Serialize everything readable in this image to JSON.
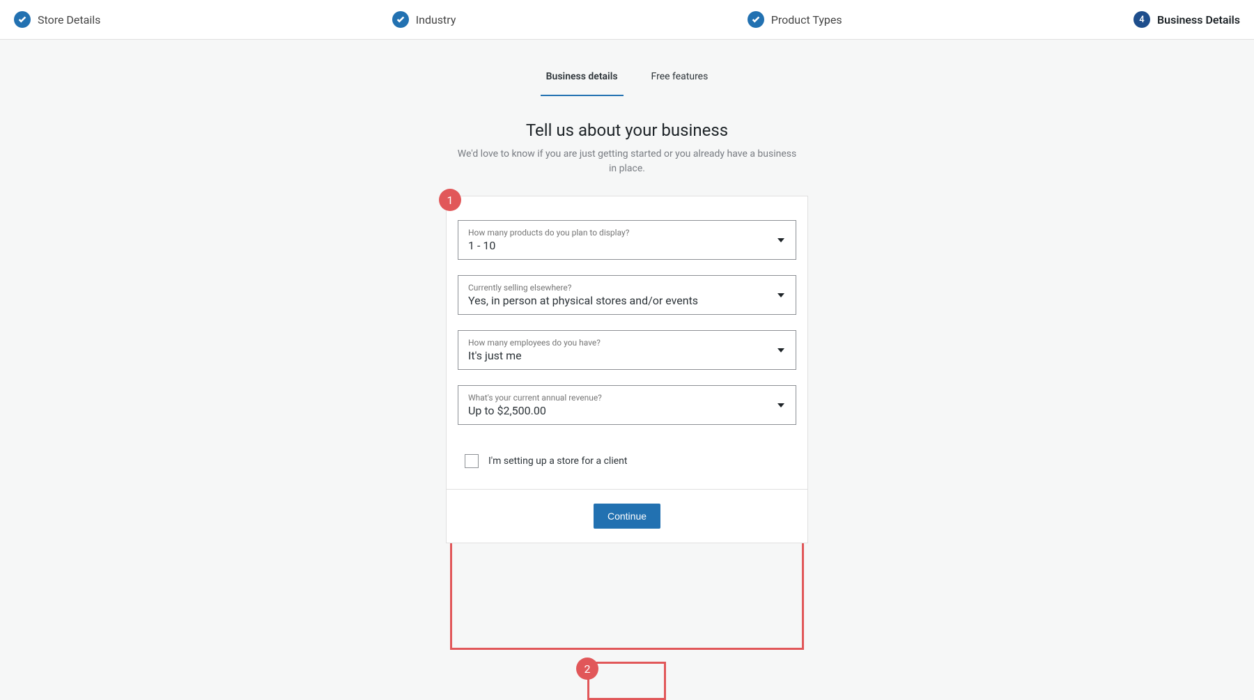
{
  "colors": {
    "accent": "#2271b1",
    "annotation": "#e15759"
  },
  "stepper": {
    "steps": [
      {
        "label": "Store Details",
        "done": true
      },
      {
        "label": "Industry",
        "done": true
      },
      {
        "label": "Product Types",
        "done": true
      },
      {
        "label": "Business Details",
        "number": "4",
        "active": true
      }
    ]
  },
  "tabs": {
    "items": [
      {
        "label": "Business details",
        "active": true
      },
      {
        "label": "Free features",
        "active": false
      }
    ]
  },
  "heading": {
    "title": "Tell us about your business",
    "subtitle": "We'd love to know if you are just getting started or you already have a business in place."
  },
  "form": {
    "fields": [
      {
        "label": "How many products do you plan to display?",
        "value": "1 - 10"
      },
      {
        "label": "Currently selling elsewhere?",
        "value": "Yes, in person at physical stores and/or events"
      },
      {
        "label": "How many employees do you have?",
        "value": "It's just me"
      },
      {
        "label": "What's your current annual revenue?",
        "value": "Up to $2,500.00"
      }
    ],
    "checkbox": {
      "checked": false,
      "label": "I'm setting up a store for a client"
    }
  },
  "footer": {
    "continue": "Continue"
  },
  "annotations": {
    "badge1": "1",
    "badge2": "2"
  }
}
